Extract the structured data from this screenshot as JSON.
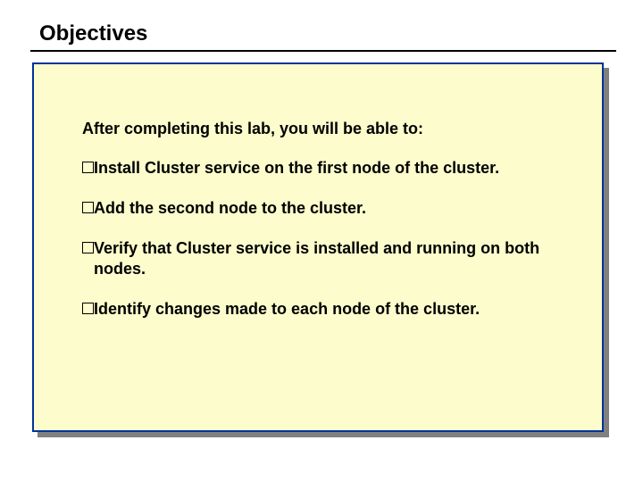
{
  "title": "Objectives",
  "intro": "After completing this lab, you will be able to:",
  "bullets": [
    "Install Cluster service on the first node of the cluster.",
    "Add the second node to the cluster.",
    "Verify that Cluster service is installed and running on both nodes.",
    "Identify changes made to each node of the cluster."
  ],
  "colors": {
    "panel_bg": "#fcfccc",
    "panel_border": "#003399",
    "shadow": "#808080"
  }
}
